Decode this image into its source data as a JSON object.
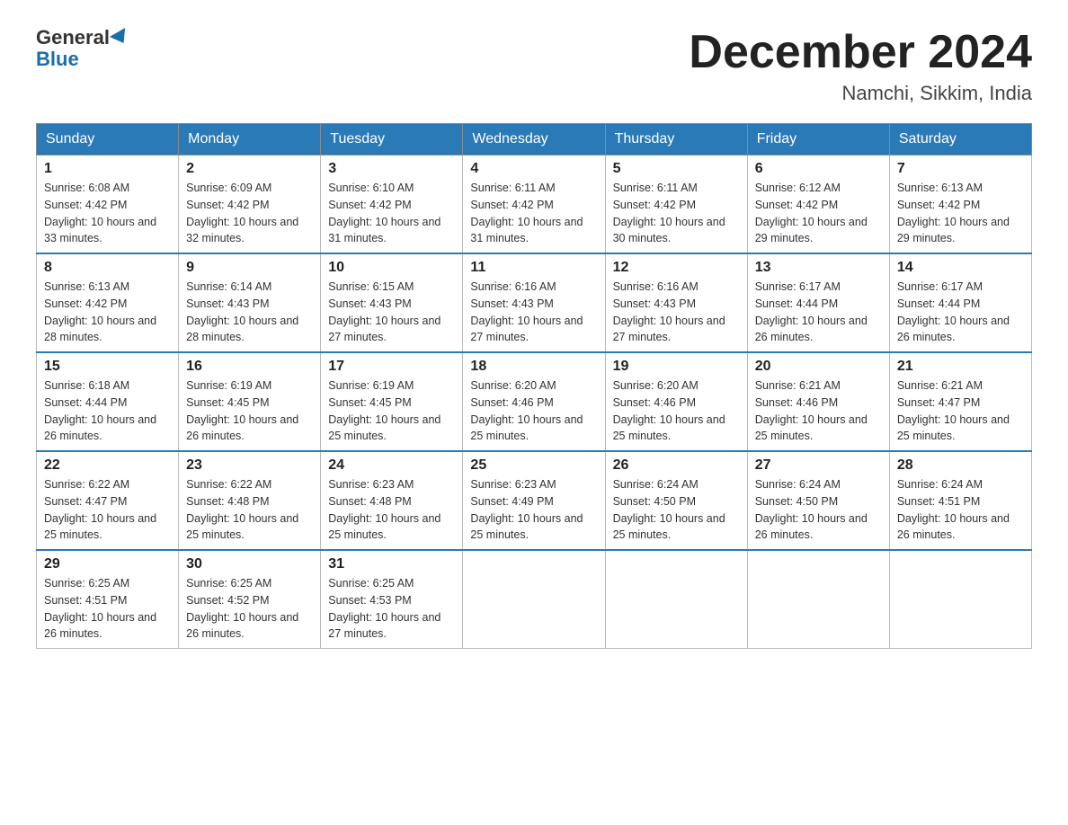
{
  "header": {
    "logo_general": "General",
    "logo_blue": "Blue",
    "month_title": "December 2024",
    "location": "Namchi, Sikkim, India"
  },
  "weekdays": [
    "Sunday",
    "Monday",
    "Tuesday",
    "Wednesday",
    "Thursday",
    "Friday",
    "Saturday"
  ],
  "weeks": [
    [
      {
        "day": "1",
        "sunrise": "6:08 AM",
        "sunset": "4:42 PM",
        "daylight": "10 hours and 33 minutes."
      },
      {
        "day": "2",
        "sunrise": "6:09 AM",
        "sunset": "4:42 PM",
        "daylight": "10 hours and 32 minutes."
      },
      {
        "day": "3",
        "sunrise": "6:10 AM",
        "sunset": "4:42 PM",
        "daylight": "10 hours and 31 minutes."
      },
      {
        "day": "4",
        "sunrise": "6:11 AM",
        "sunset": "4:42 PM",
        "daylight": "10 hours and 31 minutes."
      },
      {
        "day": "5",
        "sunrise": "6:11 AM",
        "sunset": "4:42 PM",
        "daylight": "10 hours and 30 minutes."
      },
      {
        "day": "6",
        "sunrise": "6:12 AM",
        "sunset": "4:42 PM",
        "daylight": "10 hours and 29 minutes."
      },
      {
        "day": "7",
        "sunrise": "6:13 AM",
        "sunset": "4:42 PM",
        "daylight": "10 hours and 29 minutes."
      }
    ],
    [
      {
        "day": "8",
        "sunrise": "6:13 AM",
        "sunset": "4:42 PM",
        "daylight": "10 hours and 28 minutes."
      },
      {
        "day": "9",
        "sunrise": "6:14 AM",
        "sunset": "4:43 PM",
        "daylight": "10 hours and 28 minutes."
      },
      {
        "day": "10",
        "sunrise": "6:15 AM",
        "sunset": "4:43 PM",
        "daylight": "10 hours and 27 minutes."
      },
      {
        "day": "11",
        "sunrise": "6:16 AM",
        "sunset": "4:43 PM",
        "daylight": "10 hours and 27 minutes."
      },
      {
        "day": "12",
        "sunrise": "6:16 AM",
        "sunset": "4:43 PM",
        "daylight": "10 hours and 27 minutes."
      },
      {
        "day": "13",
        "sunrise": "6:17 AM",
        "sunset": "4:44 PM",
        "daylight": "10 hours and 26 minutes."
      },
      {
        "day": "14",
        "sunrise": "6:17 AM",
        "sunset": "4:44 PM",
        "daylight": "10 hours and 26 minutes."
      }
    ],
    [
      {
        "day": "15",
        "sunrise": "6:18 AM",
        "sunset": "4:44 PM",
        "daylight": "10 hours and 26 minutes."
      },
      {
        "day": "16",
        "sunrise": "6:19 AM",
        "sunset": "4:45 PM",
        "daylight": "10 hours and 26 minutes."
      },
      {
        "day": "17",
        "sunrise": "6:19 AM",
        "sunset": "4:45 PM",
        "daylight": "10 hours and 25 minutes."
      },
      {
        "day": "18",
        "sunrise": "6:20 AM",
        "sunset": "4:46 PM",
        "daylight": "10 hours and 25 minutes."
      },
      {
        "day": "19",
        "sunrise": "6:20 AM",
        "sunset": "4:46 PM",
        "daylight": "10 hours and 25 minutes."
      },
      {
        "day": "20",
        "sunrise": "6:21 AM",
        "sunset": "4:46 PM",
        "daylight": "10 hours and 25 minutes."
      },
      {
        "day": "21",
        "sunrise": "6:21 AM",
        "sunset": "4:47 PM",
        "daylight": "10 hours and 25 minutes."
      }
    ],
    [
      {
        "day": "22",
        "sunrise": "6:22 AM",
        "sunset": "4:47 PM",
        "daylight": "10 hours and 25 minutes."
      },
      {
        "day": "23",
        "sunrise": "6:22 AM",
        "sunset": "4:48 PM",
        "daylight": "10 hours and 25 minutes."
      },
      {
        "day": "24",
        "sunrise": "6:23 AM",
        "sunset": "4:48 PM",
        "daylight": "10 hours and 25 minutes."
      },
      {
        "day": "25",
        "sunrise": "6:23 AM",
        "sunset": "4:49 PM",
        "daylight": "10 hours and 25 minutes."
      },
      {
        "day": "26",
        "sunrise": "6:24 AM",
        "sunset": "4:50 PM",
        "daylight": "10 hours and 25 minutes."
      },
      {
        "day": "27",
        "sunrise": "6:24 AM",
        "sunset": "4:50 PM",
        "daylight": "10 hours and 26 minutes."
      },
      {
        "day": "28",
        "sunrise": "6:24 AM",
        "sunset": "4:51 PM",
        "daylight": "10 hours and 26 minutes."
      }
    ],
    [
      {
        "day": "29",
        "sunrise": "6:25 AM",
        "sunset": "4:51 PM",
        "daylight": "10 hours and 26 minutes."
      },
      {
        "day": "30",
        "sunrise": "6:25 AM",
        "sunset": "4:52 PM",
        "daylight": "10 hours and 26 minutes."
      },
      {
        "day": "31",
        "sunrise": "6:25 AM",
        "sunset": "4:53 PM",
        "daylight": "10 hours and 27 minutes."
      },
      null,
      null,
      null,
      null
    ]
  ],
  "labels": {
    "sunrise": "Sunrise:",
    "sunset": "Sunset:",
    "daylight": "Daylight:"
  }
}
